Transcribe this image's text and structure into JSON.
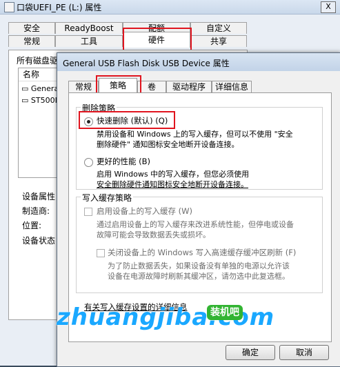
{
  "bg_window": {
    "title": "口袋UEFI_PE (L:) 属性",
    "close_label": "X",
    "tabs_row1": [
      "安全",
      "ReadyBoost",
      "配额",
      "自定义"
    ],
    "tabs_row2": [
      "常规",
      "工具",
      "硬件",
      "共享"
    ],
    "all_disks_label": "所有磁盘驱",
    "list_header": "名称",
    "list_items": [
      "Genera",
      "ST500I"
    ],
    "device_props_label": "设备属性",
    "manufacturer_label": "制造商:",
    "location_label": "位置:",
    "device_status_label": "设备状态"
  },
  "dialog": {
    "title": "General USB Flash Disk USB Device 属性",
    "tabs": [
      "常规",
      "策略",
      "卷",
      "驱动程序",
      "详细信息"
    ],
    "removal_policy": {
      "title": "删除策略",
      "quick_removal_label": "快速删除 (默认) (Q)",
      "quick_removal_desc_1": "禁用设备和 Windows 上的写入缓存，但可以不使用 \"安全",
      "quick_removal_desc_2": "删除硬件\" 通知图标安全地断开设备连接。",
      "better_perf_label": "更好的性能 (B)",
      "better_perf_desc_1": "启用 Windows 中的写入缓存，但您必须使用",
      "better_perf_desc_2": "安全删除硬件通知图标安全地断开设备连接。"
    },
    "write_cache_policy": {
      "title": "写入缓存策略",
      "enable_cache_label": "启用设备上的写入缓存 (W)",
      "enable_cache_desc_1": "通过启用设备上的写入缓存来改进系统性能，但停电或设备",
      "enable_cache_desc_2": "故障可能会导致数据丢失或损坏。",
      "disable_flush_label": "关闭设备上的 Windows 写入高速缓存缓冲区刷新 (F)",
      "disable_flush_desc_1": "为了防止数据丢失，如果设备没有单独的电源以允许该",
      "disable_flush_desc_2": "设备在电源故障时刷新其缓冲区，请勿选中此复选框。"
    },
    "more_info_link": "有关写入缓存设置的详细信息",
    "ok_label": "确定",
    "cancel_label": "取消"
  },
  "watermark": {
    "text": "zhuangjiba.com",
    "tag": "装机吧"
  },
  "colors": {
    "highlight": "#e0141e",
    "watermark": "#1aa8ff",
    "tag_bg": "#32b432"
  }
}
